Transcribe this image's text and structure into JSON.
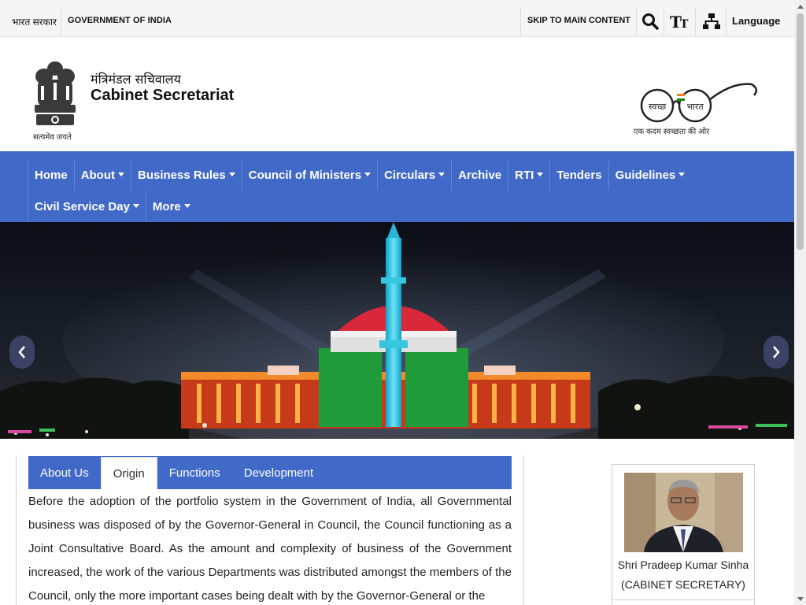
{
  "topbar": {
    "gov_hindi": "भारत सरकार",
    "gov_english": "GOVERNMENT OF INDIA",
    "skip": "SKIP TO MAIN CONTENT",
    "tools": [
      "search-icon",
      "text-size-icon",
      "sitemap-icon"
    ],
    "language": "Language"
  },
  "header": {
    "title_hindi": "मंत्रिमंडल सचिवालय",
    "title_english": "Cabinet Secretariat",
    "emblem_caption": "सत्यमेव जयते",
    "swachh_words": [
      "स्वच्छ",
      "भारत"
    ],
    "swachh_caption": "एक कदम स्वच्छता की ओर"
  },
  "nav": {
    "row1": [
      {
        "label": "Home",
        "dropdown": false
      },
      {
        "label": "About",
        "dropdown": true
      },
      {
        "label": "Business Rules",
        "dropdown": true
      },
      {
        "label": "Council of Ministers",
        "dropdown": true
      },
      {
        "label": "Circulars",
        "dropdown": true
      },
      {
        "label": "Archive",
        "dropdown": false
      },
      {
        "label": "RTI",
        "dropdown": true
      },
      {
        "label": "Tenders",
        "dropdown": false
      },
      {
        "label": "Guidelines",
        "dropdown": true
      }
    ],
    "row2": [
      {
        "label": "Civil Service Day",
        "dropdown": true
      },
      {
        "label": "More",
        "dropdown": true
      }
    ]
  },
  "tabs": {
    "items": [
      "About Us",
      "Origin",
      "Functions",
      "Development"
    ],
    "active_index": 1
  },
  "origin": {
    "text": "Before the adoption of the portfolio system in the Government of India, all Governmental business was disposed of by the Governor-General in Council, the Council functioning as a Joint Consultative Board. As the amount and complexity of business of the Government increased, the work of the various Departments was distributed amongst the members of the Council, only the more important cases being dealt with by the Governor-General or the"
  },
  "profile": {
    "name": "Shri Pradeep Kumar Sinha",
    "role": "(CABINET SECRETARY)"
  },
  "colors": {
    "nav_blue": "#4169c8",
    "topbar_bg": "#f5f5f5"
  }
}
